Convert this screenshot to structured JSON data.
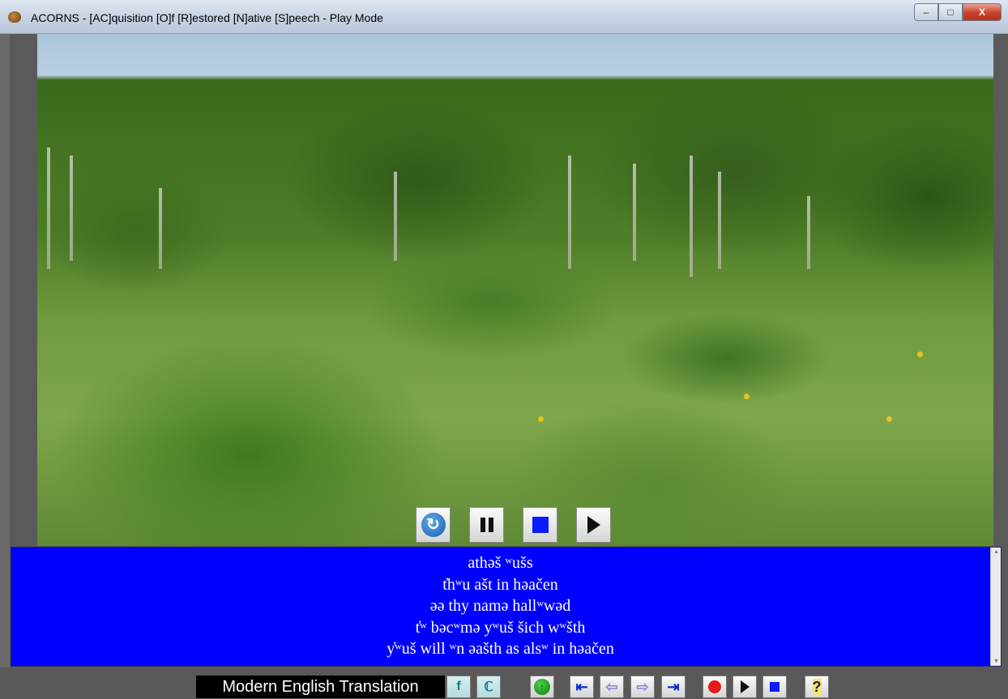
{
  "window": {
    "title": "ACORNS - [AC]quisition [O]f [R]estored [N]ative [S]peech - Play Mode",
    "controls": {
      "minimize": "–",
      "maximize": "□",
      "close": "X"
    }
  },
  "media_controls": {
    "refresh_icon": "refresh-icon",
    "pause_icon": "pause-icon",
    "stop_icon": "stop-icon",
    "play_icon": "play-icon"
  },
  "text_panel": {
    "background": "#0000ff",
    "lines": [
      "athəš ʷušs",
      "t̓hʷu ašt in həačen",
      "əə thy namə hallʷwəd",
      "t̓ʷ bəcʷmə yʷuš šich wʷšth",
      "y̓ʷuš will ʷn əašth as alsʷ in həačen"
    ]
  },
  "toolbar": {
    "translation_label": "Modern English Translation",
    "help_glyph": "?",
    "font_glyph": "f"
  },
  "colors": {
    "record": "#e31b1b",
    "stop": "#0a1cff",
    "panel": "#0000ff"
  }
}
